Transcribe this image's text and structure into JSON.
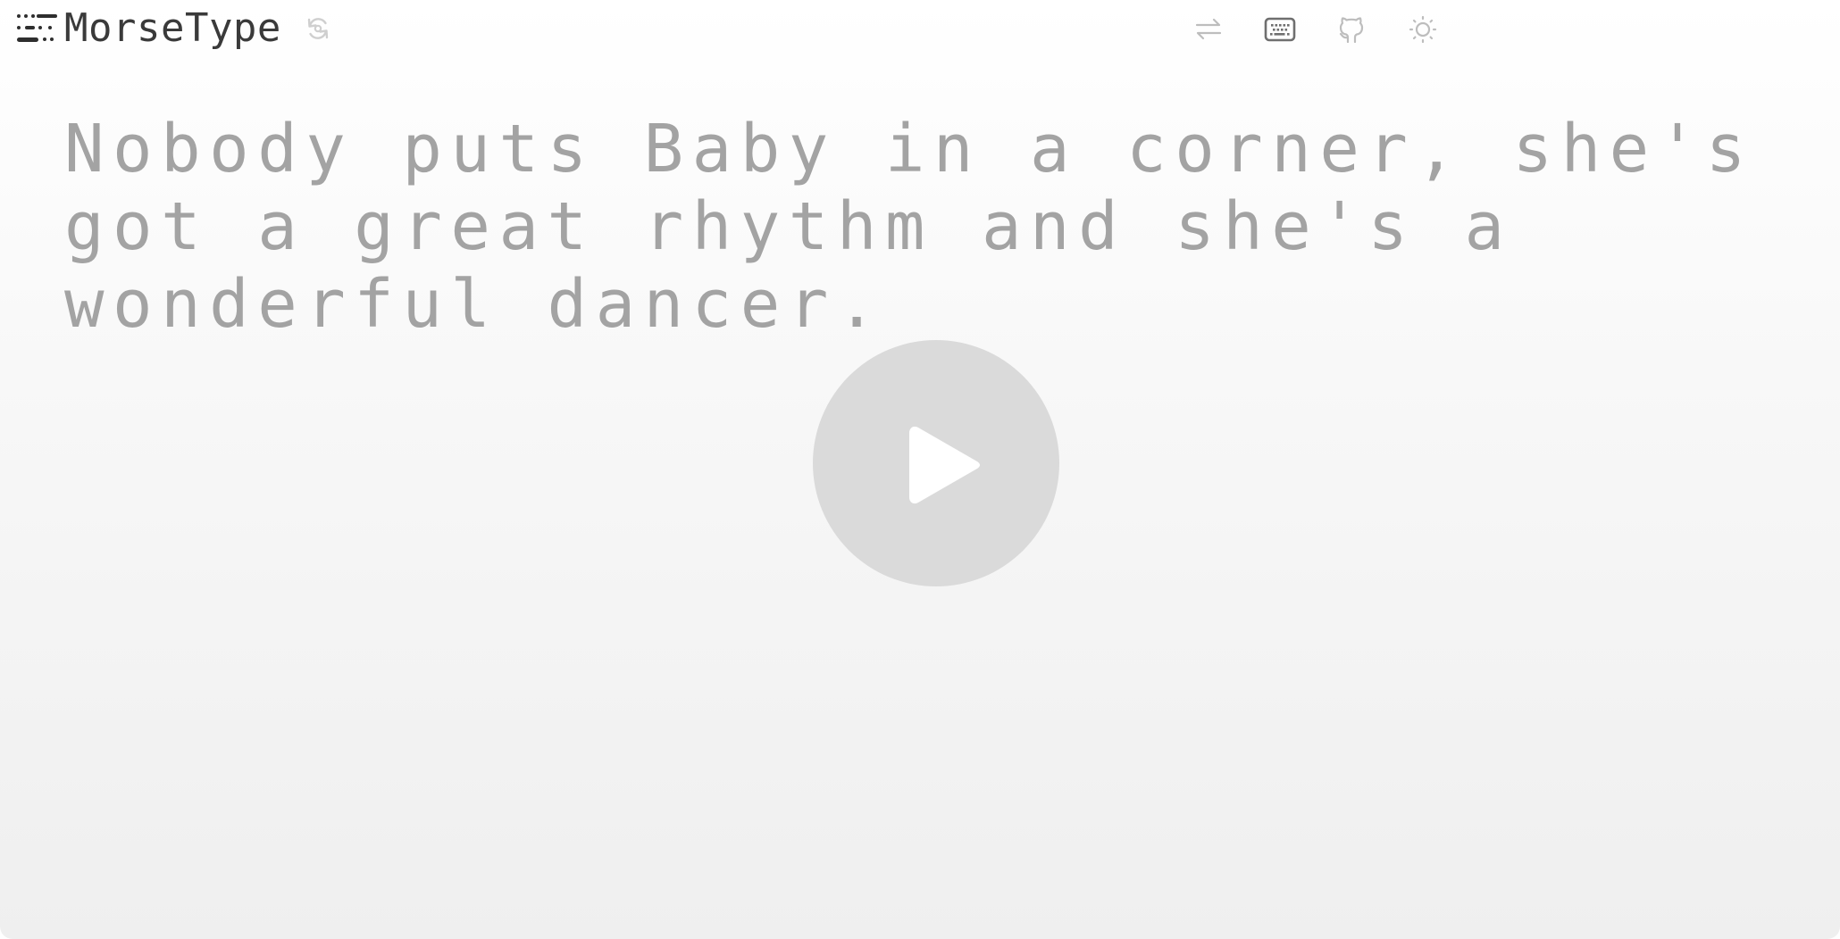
{
  "header": {
    "app_name": "MorseType"
  },
  "icons": {
    "logo": "morse-logo-icon",
    "reset": "refresh-icon",
    "swap": "arrows-swap-icon",
    "keyboard": "keyboard-icon",
    "github": "github-icon",
    "theme": "sun-icon",
    "play": "play-icon"
  },
  "main": {
    "phrase": "Nobody puts Baby in a corner, she's got a great rhythm and she's a wonderful dancer."
  },
  "colors": {
    "title": "#3a3a3a",
    "phrase": "#a3a3a3",
    "play_circle": "#dadada",
    "icons": "#bdbdbd",
    "keyboard_active": "#6f6f6f"
  }
}
